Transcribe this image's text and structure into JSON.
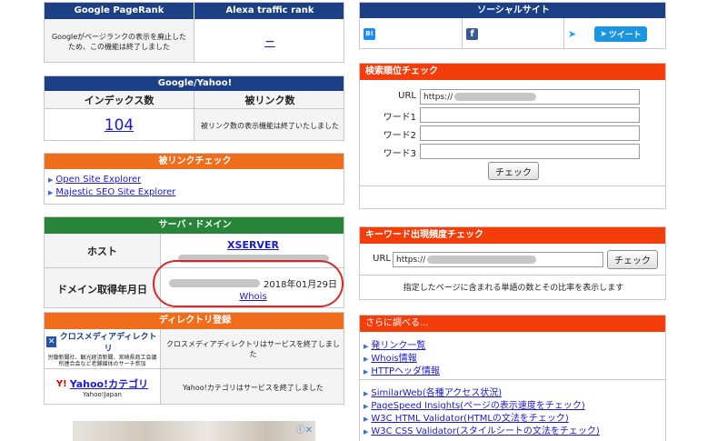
{
  "pagerank": {
    "header_left": "Google PageRank",
    "header_right": "Alexa traffic rank",
    "notice": "Googleがページランクの表示を廃止したため、この機能は終了しました",
    "alexa_value": "−"
  },
  "google_yahoo": {
    "header": "Google/Yahoo!",
    "index_label": "インデックス数",
    "backlink_label": "被リンク数",
    "index_value": "104",
    "backlink_notice": "被リンク数の表示機能は終了いたしました"
  },
  "backlink_check": {
    "header": "被リンクチェック",
    "links": [
      "Open Site Explorer",
      "Majestic SEO Site Explorer"
    ]
  },
  "server_domain": {
    "header": "サーバ・ドメイン",
    "host_label": "ホスト",
    "host_value": "XSERVER",
    "domain_date_label": "ドメイン取得年月日",
    "domain_date_value": "2018年01月29日",
    "whois_link": "Whois"
  },
  "directory": {
    "header": "ディレクトリ登録",
    "cross_media_logo": "クロスメディアディレクトリ",
    "cross_media_sub": "労働新聞社、観光経済新聞、宮崎県商工会議所連合会など老舗媒体のサーチ参加",
    "cross_media_notice": "クロスメディアディレクトリはサービスを終了しました",
    "yahoo_logo": "Yahoo!カテゴリ",
    "yahoo_sub": "Yahoo!Japan",
    "yahoo_notice": "Yahoo!カテゴリはサービスを終了しました"
  },
  "social": {
    "header": "ソーシャルサイト",
    "tweet_label": "ツイート"
  },
  "rank_check": {
    "header": "検索順位チェック",
    "url_label": "URL",
    "url_value": "https://",
    "word1_label": "ワード1",
    "word2_label": "ワード2",
    "word3_label": "ワード3",
    "check_button": "チェック"
  },
  "keyword_freq": {
    "header": "キーワード出現頻度チェック",
    "url_label": "URL",
    "url_value": "https://",
    "check_button": "チェック",
    "description": "指定したページに含まれる単語の数とその比率を表示します"
  },
  "more": {
    "header": "さらに調べる...",
    "group1": [
      "発リンク一覧",
      "Whois情報",
      "HTTPヘッダ情報"
    ],
    "group2": [
      "SimilarWeb(各種アクセス状況)",
      "PageSpeed Insights(ページの表示速度をチェック)",
      "W3C HTML Validator(HTMLの文法をチェック)",
      "W3C CSS Validator(スタイルシートの文法をチェック)"
    ]
  },
  "ad": {
    "badge": "ⓘ✕"
  },
  "colors": {
    "blue_header": "#1c3f86",
    "orange_header": "#f06d1c",
    "green_header": "#27853a",
    "red_header": "#f33e0c",
    "highlight_circle": "#d42a2a"
  },
  "icons": [
    "bookmark-b-icon",
    "facebook-icon",
    "twitter-bird-icon",
    "close-icon",
    "info-icon"
  ]
}
